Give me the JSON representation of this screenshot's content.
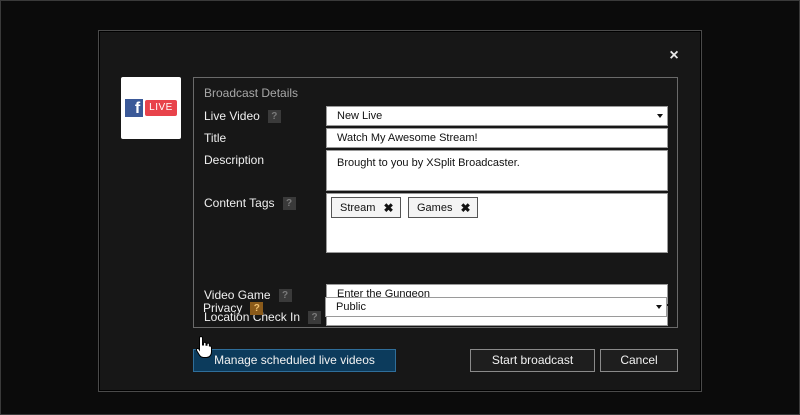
{
  "dialog": {
    "close_glyph": "×",
    "brand": {
      "f_letter": "f",
      "live_label": "LIVE"
    },
    "group_title": "Broadcast Details",
    "fields": {
      "live_video": {
        "label": "Live Video",
        "value": "New Live",
        "help": "?"
      },
      "title": {
        "label": "Title",
        "value": "Watch My Awesome Stream!"
      },
      "description": {
        "label": "Description",
        "value": "Brought to you by XSplit Broadcaster."
      },
      "content_tags": {
        "label": "Content Tags",
        "help": "?",
        "tags": [
          "Stream",
          "Games"
        ],
        "remove_glyph": "✖"
      },
      "video_game": {
        "label": "Video Game",
        "help": "?",
        "value": "Enter the Gungeon"
      },
      "location": {
        "label": "Location Check In",
        "help": "?",
        "value": ""
      },
      "privacy": {
        "label": "Privacy",
        "help": "?",
        "value": "Public"
      }
    },
    "buttons": {
      "manage": "Manage scheduled live videos",
      "start": "Start broadcast",
      "cancel": "Cancel"
    }
  },
  "colors": {
    "background": "#0b0b0b",
    "dialog": "#171717",
    "primary_button": "#0c3b5c",
    "facebook_blue": "#3b5998",
    "live_red": "#e8434b",
    "privacy_help": "#8a5a1a"
  },
  "icons": {
    "close": "close-icon",
    "select_arrow": "chevron-down-icon",
    "tag_remove": "close-icon",
    "help": "help-icon",
    "pointer": "hand-pointer-icon"
  }
}
